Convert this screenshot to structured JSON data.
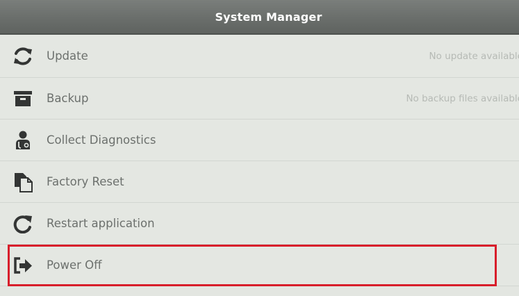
{
  "window": {
    "title": "System Manager"
  },
  "menu": {
    "items": [
      {
        "icon": "refresh-icon",
        "label": "Update",
        "status": "No update available"
      },
      {
        "icon": "archive-box-icon",
        "label": "Backup",
        "status": "No backup files available"
      },
      {
        "icon": "technician-icon",
        "label": "Collect Diagnostics",
        "status": ""
      },
      {
        "icon": "document-reset-icon",
        "label": "Factory Reset",
        "status": ""
      },
      {
        "icon": "restart-arrow-icon",
        "label": "Restart application",
        "status": ""
      },
      {
        "icon": "exit-arrow-icon",
        "label": "Power Off",
        "status": ""
      }
    ]
  },
  "highlight": {
    "target": "Power Off",
    "color": "#d81e2b"
  },
  "colors": {
    "title_bar": "#6a6e6b",
    "background": "#e3e6e1",
    "label_text": "#6c706d",
    "status_text": "#b6bab5",
    "icon": "#333534"
  }
}
